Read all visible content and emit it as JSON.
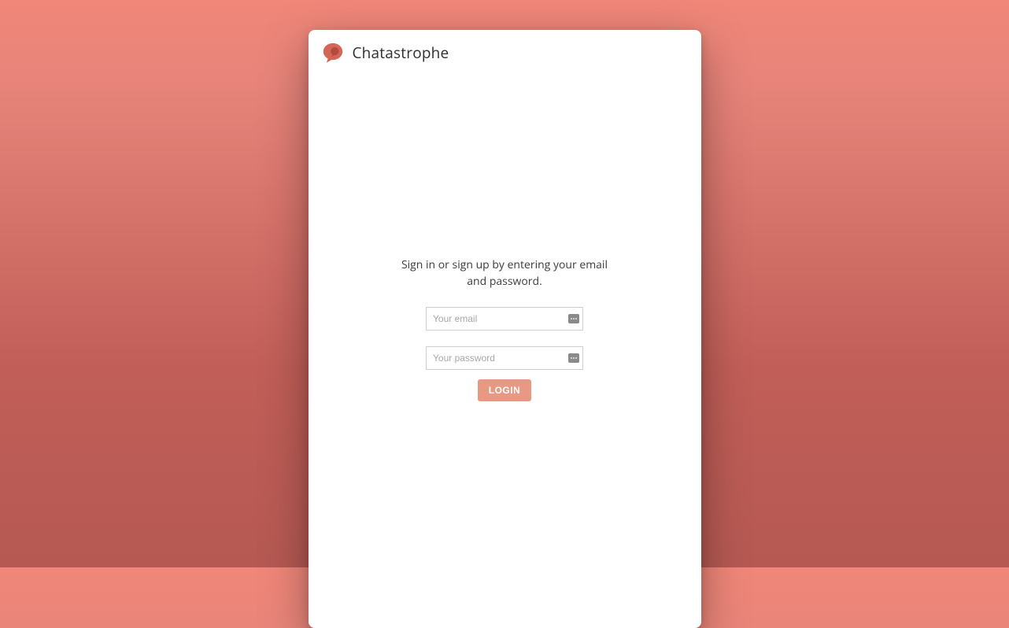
{
  "brand": {
    "title": "Chatastrophe"
  },
  "login": {
    "instructions": "Sign in or sign up by entering your email and password.",
    "email_placeholder": "Your email",
    "email_value": "",
    "password_placeholder": "Your password",
    "password_value": "",
    "submit_label": "LOGIN"
  },
  "colors": {
    "accent": "#E89984",
    "logo_outer": "#D56556",
    "logo_inner": "#B24A3E"
  }
}
